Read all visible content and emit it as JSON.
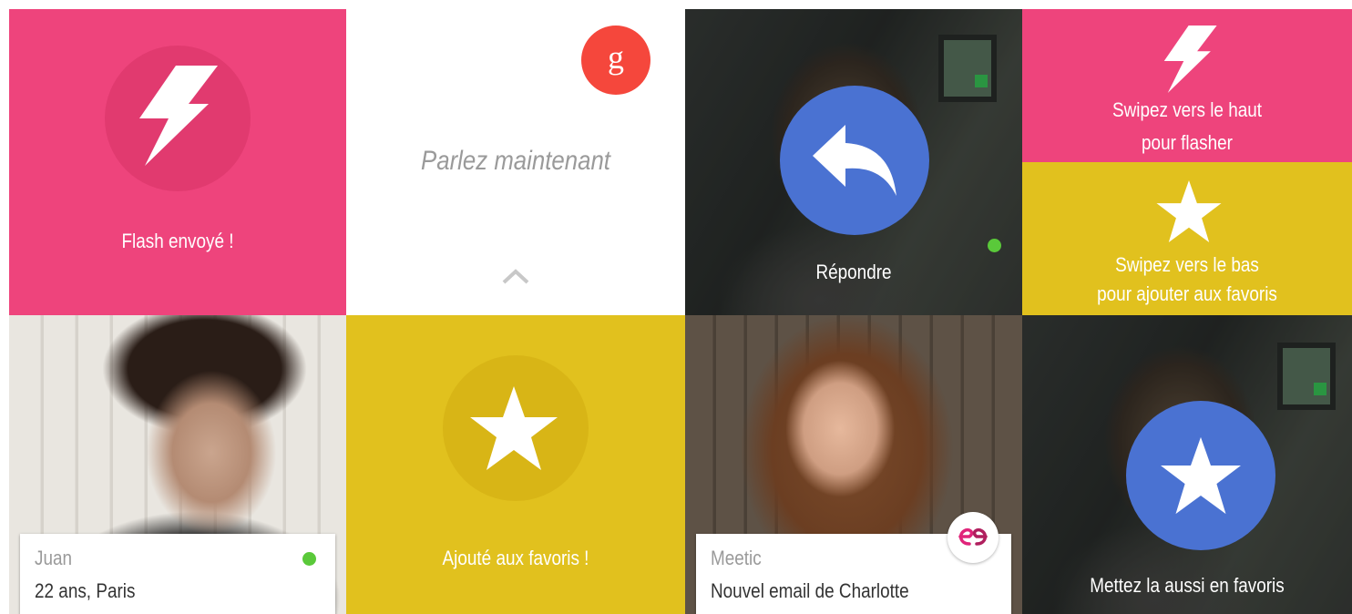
{
  "colors": {
    "pink": "#ee447c",
    "yellow": "#e1c11e",
    "blue": "#4a72d2",
    "google_red": "#f5473c",
    "online_green": "#5ac93a"
  },
  "tiles": {
    "flash": {
      "caption": "Flash envoyé !",
      "icon": "lightning-icon"
    },
    "voice": {
      "prompt": "Parlez maintenant",
      "logo_letter": "g",
      "icon": "chevron-up-icon"
    },
    "reply": {
      "caption": "Répondre",
      "icon": "reply-arrow-icon"
    },
    "swipe_up": {
      "line1": "Swipez vers le haut",
      "line2": "pour flasher",
      "icon": "lightning-icon"
    },
    "swipe_down": {
      "line1": "Swipez vers le bas",
      "line2": "pour ajouter aux favoris",
      "icon": "star-icon"
    },
    "juan": {
      "name": "Juan",
      "details": "22 ans, Paris",
      "status": "online"
    },
    "favorite": {
      "caption": "Ajouté aux favoris !",
      "icon": "star-icon"
    },
    "meetic": {
      "app": "Meetic",
      "message": "Nouvel email de Charlotte",
      "logo": "meetic-logo"
    },
    "fav_too": {
      "caption": "Mettez la aussi en favoris",
      "icon": "star-icon"
    }
  }
}
